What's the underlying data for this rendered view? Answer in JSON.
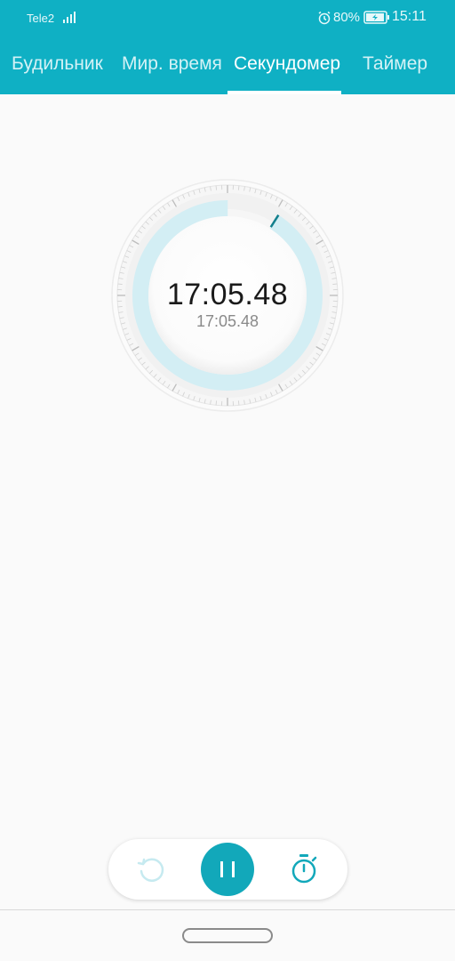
{
  "status_bar": {
    "carrier": "Tele2",
    "battery_percent": "80%",
    "time": "15:11",
    "icons": [
      "signal-icon",
      "alarm-icon",
      "battery-charging-icon"
    ]
  },
  "tabs": [
    {
      "label": "Будильник",
      "active": false
    },
    {
      "label": "Мир. время",
      "active": false
    },
    {
      "label": "Секундомер",
      "active": true
    },
    {
      "label": "Таймер",
      "active": false
    }
  ],
  "stopwatch": {
    "elapsed": "17:05.48",
    "lap": "17:05.48",
    "progress_fraction": 0.09
  },
  "controls": {
    "icons": [
      "reset-icon",
      "pause-icon",
      "lap-stopwatch-icon"
    ]
  },
  "colors": {
    "accent": "#0fb0c4",
    "button": "#12a8ba",
    "progress_ring": "#d3eef4",
    "background": "#fafafa"
  }
}
